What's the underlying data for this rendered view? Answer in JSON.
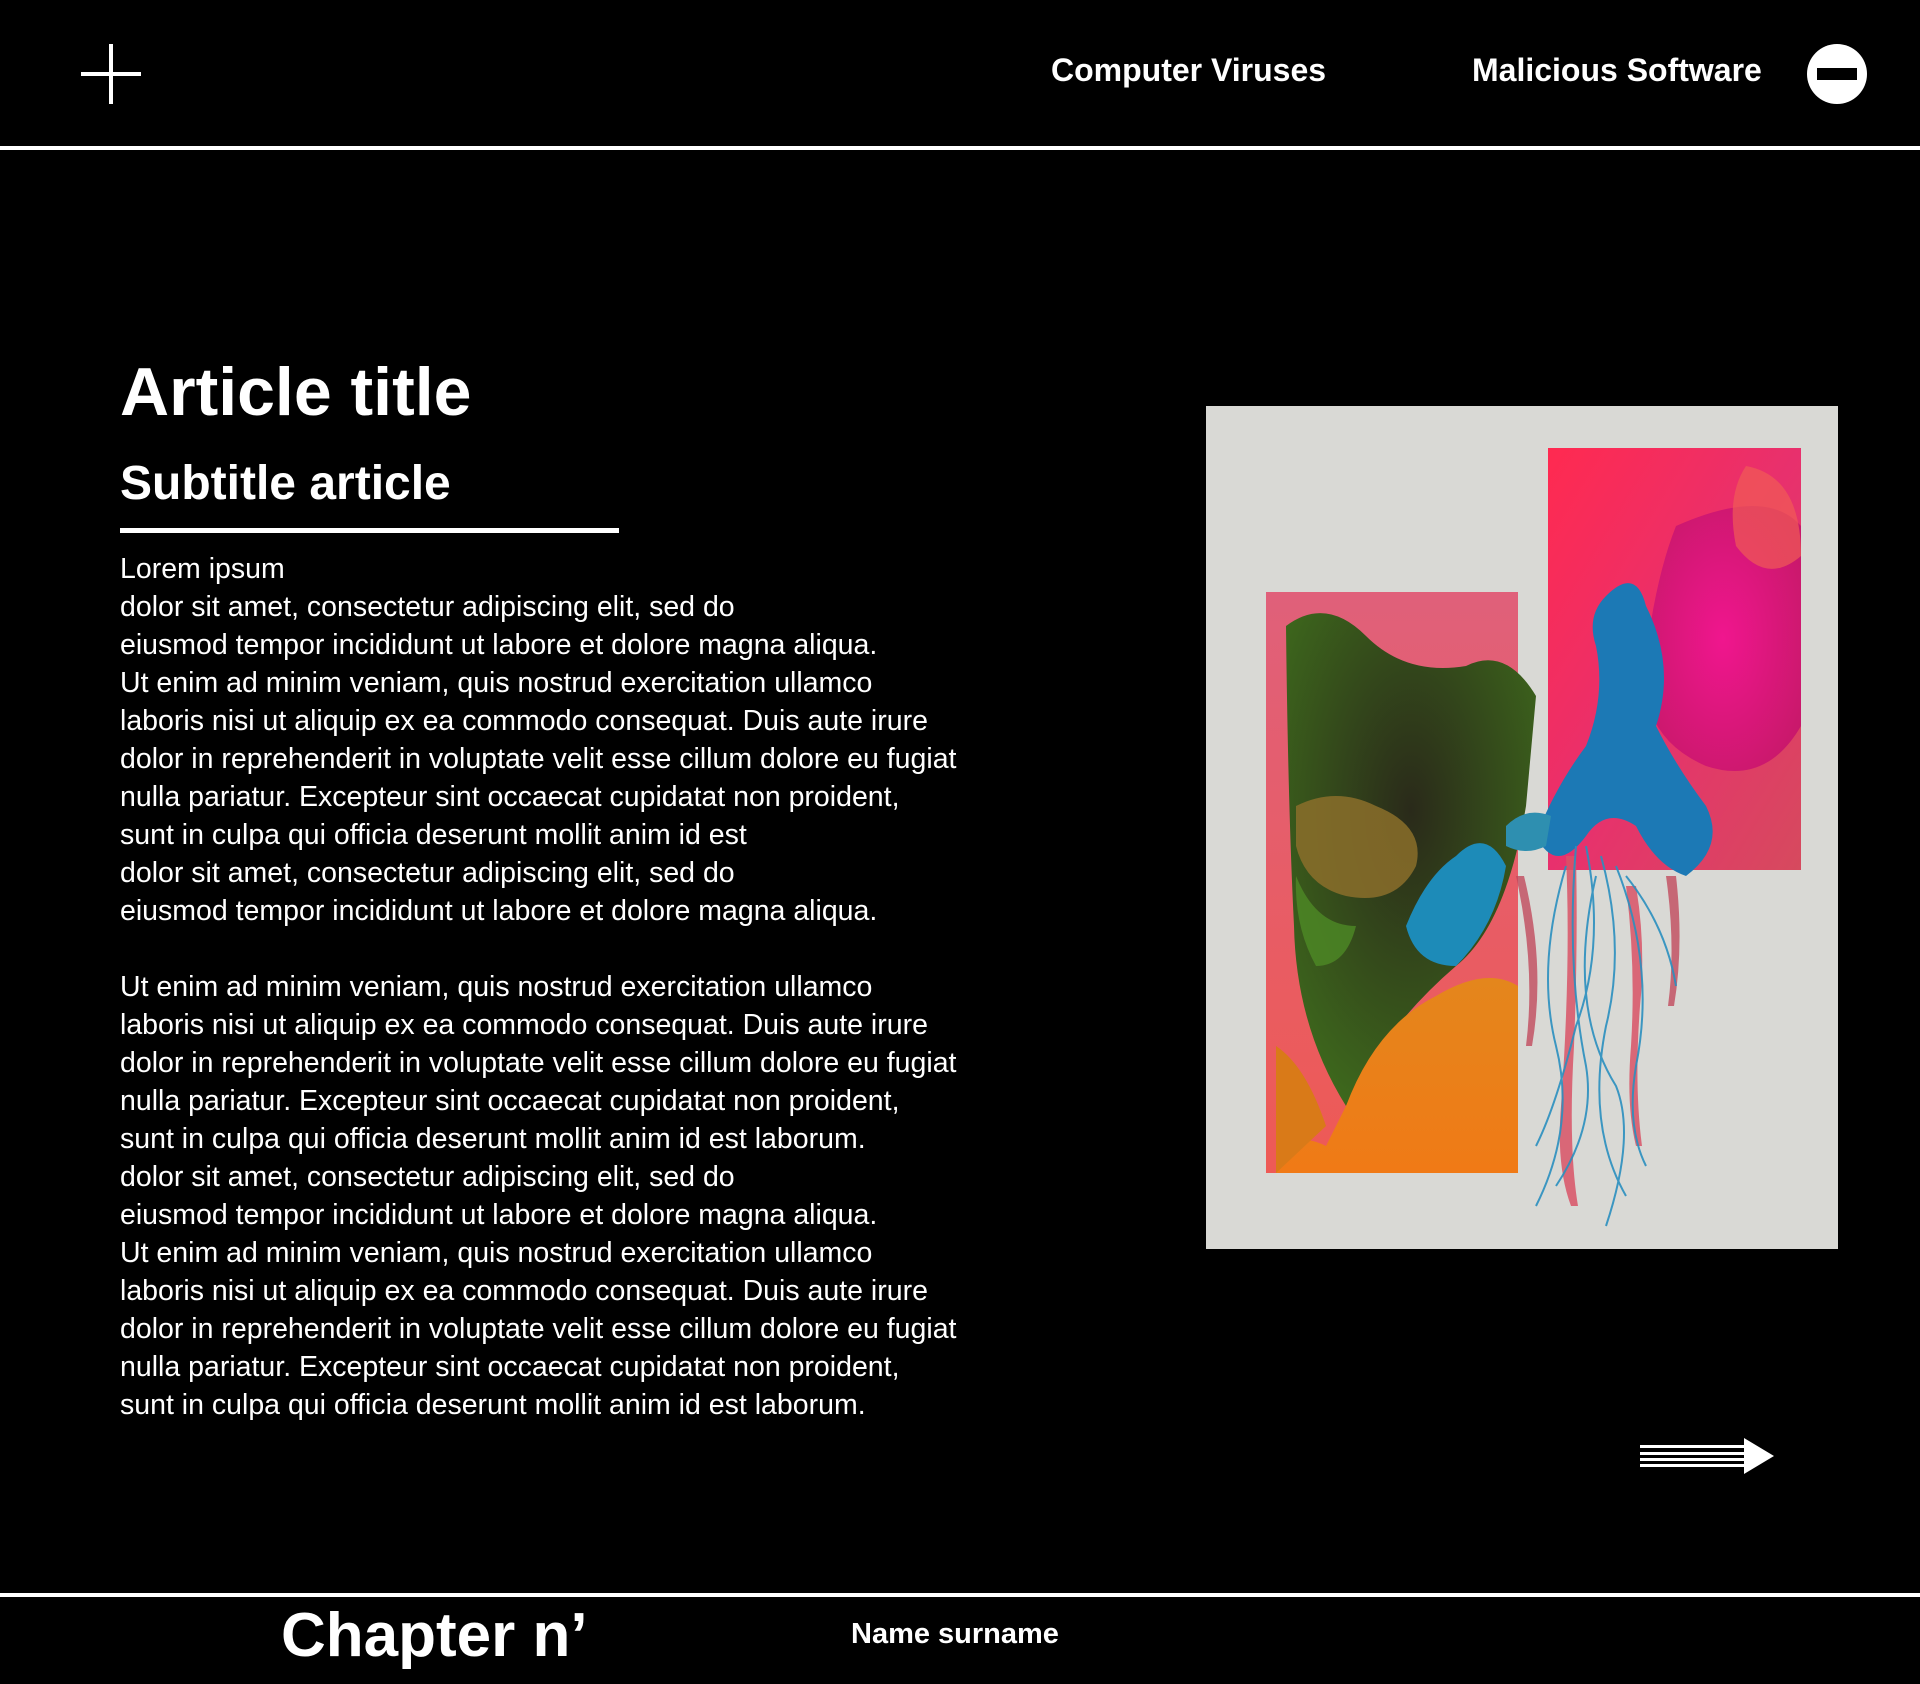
{
  "header": {
    "menu_icon": "plus-icon",
    "nav": [
      {
        "label": "Computer Viruses"
      },
      {
        "label": "Malicious Software"
      }
    ],
    "close_icon": "minus-circle-icon"
  },
  "article": {
    "title": "Article title",
    "subtitle": "Subtitle article",
    "paragraphs": [
      "Lorem ipsum\ndolor sit amet, consectetur adipiscing elit, sed do\neiusmod tempor incididunt ut labore et dolore magna aliqua.\nUt enim ad minim veniam, quis nostrud exercitation ullamco\nlaboris nisi ut aliquip ex ea commodo consequat. Duis aute irure\ndolor in reprehenderit in voluptate velit esse cillum dolore eu fugiat\nnulla pariatur. Excepteur sint occaecat cupidatat non proident,\nsunt in culpa qui officia deserunt mollit anim id est\ndolor sit amet, consectetur adipiscing elit, sed do\neiusmod tempor incididunt ut labore et dolore magna aliqua.",
      "Ut enim ad minim veniam, quis nostrud exercitation ullamco\nlaboris nisi ut aliquip ex ea commodo consequat. Duis aute irure\ndolor in reprehenderit in voluptate velit esse cillum dolore eu fugiat\nnulla pariatur. Excepteur sint occaecat cupidatat non proident,\nsunt in culpa qui officia deserunt mollit anim id est laborum.\ndolor sit amet, consectetur adipiscing elit, sed do\neiusmod tempor incididunt ut labore et dolore magna aliqua.\nUt enim ad minim veniam, quis nostrud exercitation ullamco\nlaboris nisi ut aliquip ex ea commodo consequat. Duis aute irure\ndolor in reprehenderit in voluptate velit esse cillum dolore eu fugiat\nnulla pariatur. Excepteur sint occaecat cupidatat non proident,\nsunt in culpa qui officia deserunt mollit anim id est laborum."
    ]
  },
  "artwork": {
    "icon": "abstract-artwork",
    "colors": {
      "background": "#d9d9d5",
      "pink": "#ff2f7a",
      "magenta": "#e0107f",
      "orange": "#e9851a",
      "green": "#5e8b25",
      "blue": "#1f86b6"
    }
  },
  "next": {
    "icon": "arrow-right-icon"
  },
  "footer": {
    "chapter": "Chapter n’",
    "author": "Name surname"
  },
  "colors": {
    "background": "#000000",
    "foreground": "#ffffff"
  }
}
